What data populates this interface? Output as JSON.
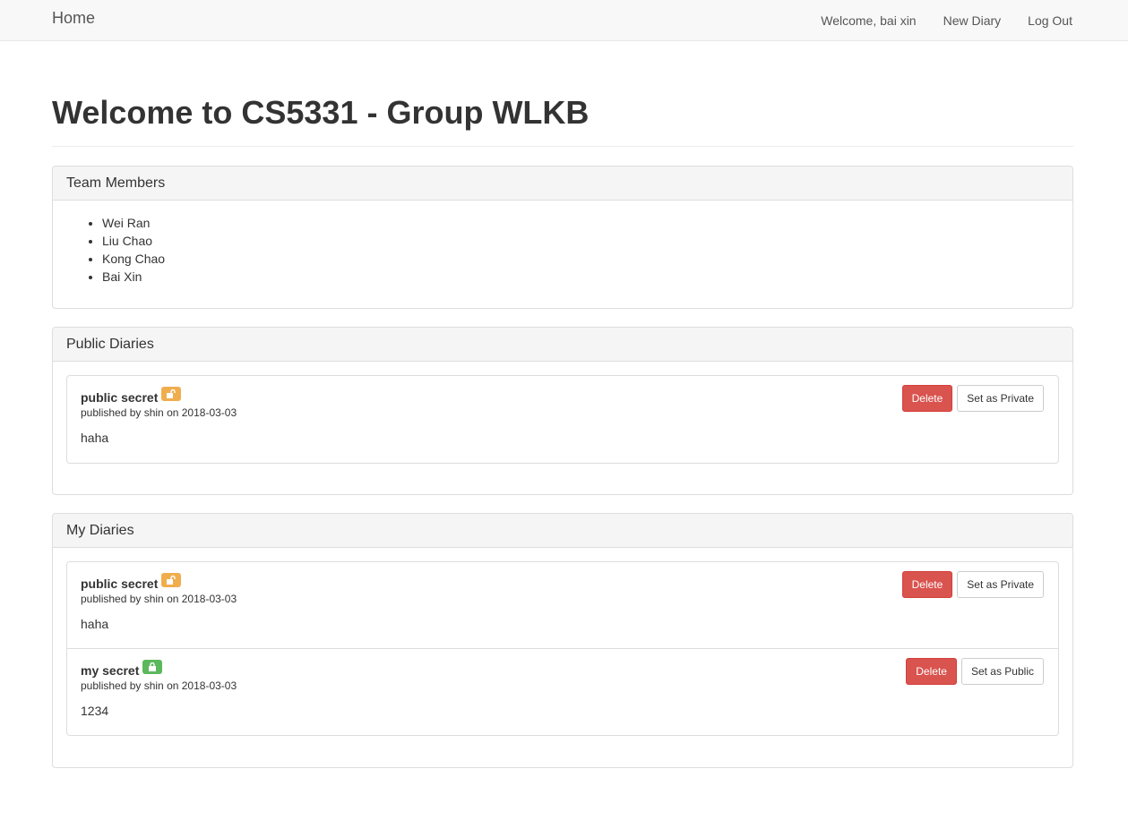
{
  "navbar": {
    "brand": "Home",
    "links": [
      "Welcome, bai xin",
      "New Diary",
      "Log Out"
    ]
  },
  "page": {
    "title": "Welcome to CS5331 - Group WLKB"
  },
  "team": {
    "heading": "Team Members",
    "members": [
      "Wei Ran",
      "Liu Chao",
      "Kong Chao",
      "Bai Xin"
    ]
  },
  "public_diaries": {
    "heading": "Public Diaries",
    "items": [
      {
        "title": "public secret",
        "meta": "published by shin on 2018-03-03",
        "body": "haha",
        "status_icon": "unlock-icon",
        "status_color": "#f0ad4e",
        "delete_label": "Delete",
        "toggle_label": "Set as Private"
      }
    ]
  },
  "my_diaries": {
    "heading": "My Diaries",
    "items": [
      {
        "title": "public secret",
        "meta": "published by shin on 2018-03-03",
        "body": "haha",
        "status_icon": "unlock-icon",
        "status_color": "#f0ad4e",
        "delete_label": "Delete",
        "toggle_label": "Set as Private"
      },
      {
        "title": "my secret",
        "meta": "published by shin on 2018-03-03",
        "body": "1234",
        "status_icon": "lock-icon",
        "status_color": "#5cb85c",
        "delete_label": "Delete",
        "toggle_label": "Set as Public"
      }
    ]
  },
  "colors": {
    "danger": "#d9534f",
    "warning": "#f0ad4e",
    "success": "#5cb85c",
    "navbar_bg": "#f8f8f8"
  }
}
